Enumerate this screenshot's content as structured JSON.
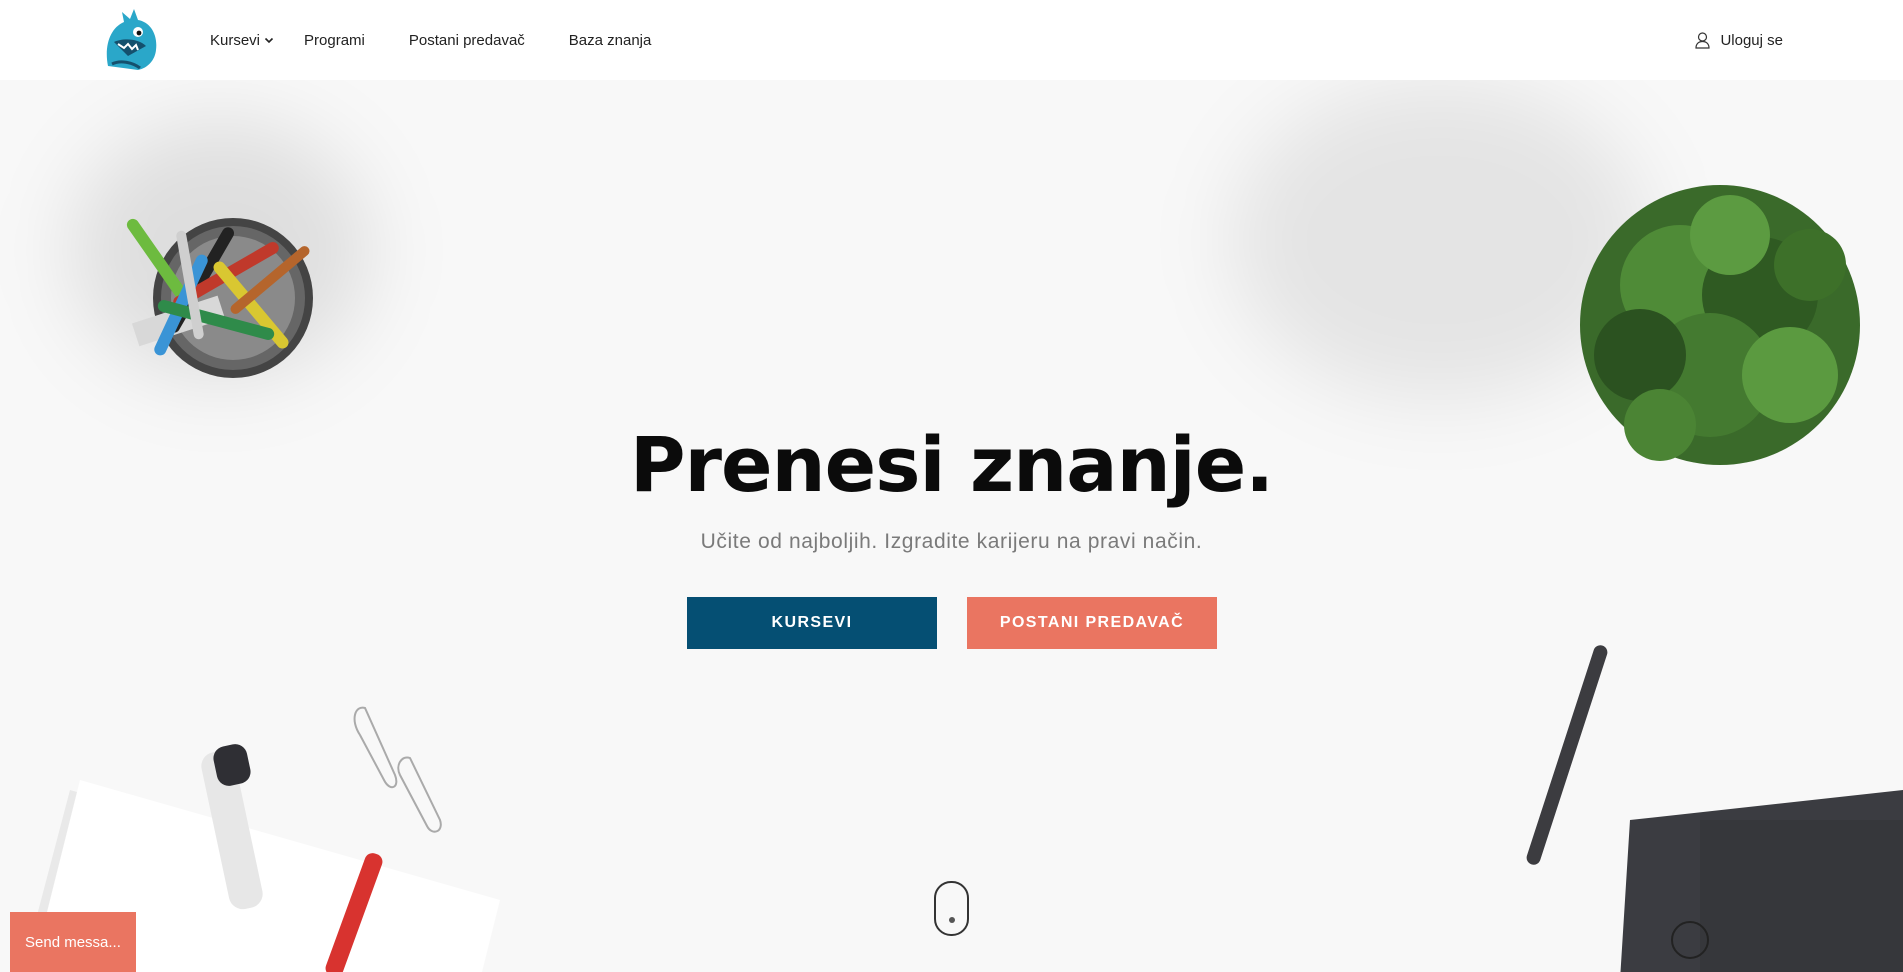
{
  "header": {
    "logo": "dragon-logo",
    "nav": [
      {
        "label": "Kursevi",
        "dropdown": true
      },
      {
        "label": "Programi"
      },
      {
        "label": "Postani predavač"
      },
      {
        "label": "Baza znanja"
      }
    ],
    "login_label": "Uloguj se",
    "login_icon": "user-icon"
  },
  "hero": {
    "title": "Prenesi znanje.",
    "subtitle": "Učite od najboljih. Izgradite karijeru na pravi način.",
    "primary_button": "KURSEVI",
    "secondary_button": "POSTANI PREDAVAČ",
    "scroll_icon": "mouse-scroll-icon"
  },
  "chat": {
    "label": "Send messa..."
  },
  "colors": {
    "primary": "#054f73",
    "accent": "#ea7561",
    "background": "#f8f8f8"
  }
}
